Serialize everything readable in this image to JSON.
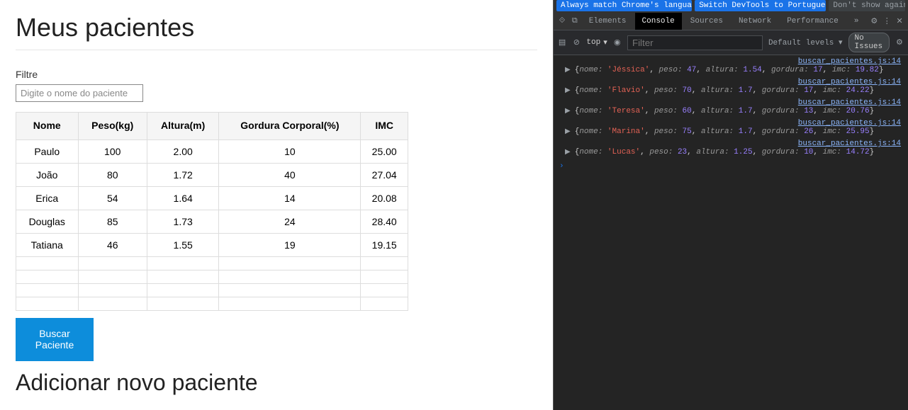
{
  "page": {
    "title": "Meus pacientes",
    "filter_label": "Filtre",
    "filter_placeholder": "Digite o nome do paciente",
    "search_button": "Buscar Paciente",
    "add_heading": "Adicionar novo paciente"
  },
  "table": {
    "headers": {
      "nome": "Nome",
      "peso": "Peso(kg)",
      "altura": "Altura(m)",
      "gordura": "Gordura Corporal(%)",
      "imc": "IMC"
    },
    "rows": [
      {
        "nome": "Paulo",
        "peso": "100",
        "altura": "2.00",
        "gordura": "10",
        "imc": "25.00"
      },
      {
        "nome": "João",
        "peso": "80",
        "altura": "1.72",
        "gordura": "40",
        "imc": "27.04"
      },
      {
        "nome": "Erica",
        "peso": "54",
        "altura": "1.64",
        "gordura": "14",
        "imc": "20.08"
      },
      {
        "nome": "Douglas",
        "peso": "85",
        "altura": "1.73",
        "gordura": "24",
        "imc": "28.40"
      },
      {
        "nome": "Tatiana",
        "peso": "46",
        "altura": "1.55",
        "gordura": "19",
        "imc": "19.15"
      }
    ],
    "empty_row_count": 4
  },
  "devtools": {
    "banner": {
      "match": "Always match Chrome's language",
      "switch": "Switch DevTools to Portuguese",
      "dont": "Don't show again"
    },
    "tabs": {
      "elements": "Elements",
      "console": "Console",
      "sources": "Sources",
      "network": "Network",
      "performance": "Performance",
      "more": "»"
    },
    "toolbar": {
      "top": "top",
      "filter_placeholder": "Filter",
      "levels": "Default levels",
      "issues": "No Issues"
    },
    "source_link": "buscar_pacientes.js:14",
    "logs": [
      {
        "nome": "Jéssica",
        "peso": "47",
        "altura": "1.54",
        "gordura": "17",
        "imc": "19.82"
      },
      {
        "nome": "Flavio",
        "peso": "70",
        "altura": "1.7",
        "gordura": "17",
        "imc": "24.22"
      },
      {
        "nome": "Teresa",
        "peso": "60",
        "altura": "1.7",
        "gordura": "13",
        "imc": "20.76"
      },
      {
        "nome": "Marina",
        "peso": "75",
        "altura": "1.7",
        "gordura": "26",
        "imc": "25.95"
      },
      {
        "nome": "Lucas",
        "peso": "23",
        "altura": "1.25",
        "gordura": "10",
        "imc": "14.72"
      }
    ]
  }
}
